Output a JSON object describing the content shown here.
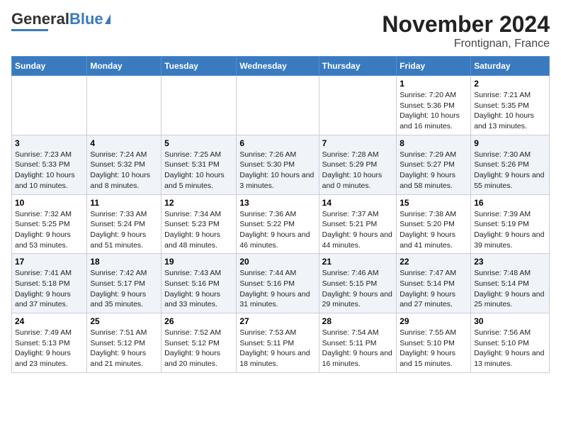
{
  "header": {
    "logo_general": "General",
    "logo_blue": "Blue",
    "title": "November 2024",
    "subtitle": "Frontignan, France"
  },
  "columns": [
    "Sunday",
    "Monday",
    "Tuesday",
    "Wednesday",
    "Thursday",
    "Friday",
    "Saturday"
  ],
  "weeks": [
    {
      "days": [
        {
          "num": "",
          "info": ""
        },
        {
          "num": "",
          "info": ""
        },
        {
          "num": "",
          "info": ""
        },
        {
          "num": "",
          "info": ""
        },
        {
          "num": "",
          "info": ""
        },
        {
          "num": "1",
          "info": "Sunrise: 7:20 AM\nSunset: 5:36 PM\nDaylight: 10 hours and 16 minutes."
        },
        {
          "num": "2",
          "info": "Sunrise: 7:21 AM\nSunset: 5:35 PM\nDaylight: 10 hours and 13 minutes."
        }
      ]
    },
    {
      "days": [
        {
          "num": "3",
          "info": "Sunrise: 7:23 AM\nSunset: 5:33 PM\nDaylight: 10 hours and 10 minutes."
        },
        {
          "num": "4",
          "info": "Sunrise: 7:24 AM\nSunset: 5:32 PM\nDaylight: 10 hours and 8 minutes."
        },
        {
          "num": "5",
          "info": "Sunrise: 7:25 AM\nSunset: 5:31 PM\nDaylight: 10 hours and 5 minutes."
        },
        {
          "num": "6",
          "info": "Sunrise: 7:26 AM\nSunset: 5:30 PM\nDaylight: 10 hours and 3 minutes."
        },
        {
          "num": "7",
          "info": "Sunrise: 7:28 AM\nSunset: 5:29 PM\nDaylight: 10 hours and 0 minutes."
        },
        {
          "num": "8",
          "info": "Sunrise: 7:29 AM\nSunset: 5:27 PM\nDaylight: 9 hours and 58 minutes."
        },
        {
          "num": "9",
          "info": "Sunrise: 7:30 AM\nSunset: 5:26 PM\nDaylight: 9 hours and 55 minutes."
        }
      ]
    },
    {
      "days": [
        {
          "num": "10",
          "info": "Sunrise: 7:32 AM\nSunset: 5:25 PM\nDaylight: 9 hours and 53 minutes."
        },
        {
          "num": "11",
          "info": "Sunrise: 7:33 AM\nSunset: 5:24 PM\nDaylight: 9 hours and 51 minutes."
        },
        {
          "num": "12",
          "info": "Sunrise: 7:34 AM\nSunset: 5:23 PM\nDaylight: 9 hours and 48 minutes."
        },
        {
          "num": "13",
          "info": "Sunrise: 7:36 AM\nSunset: 5:22 PM\nDaylight: 9 hours and 46 minutes."
        },
        {
          "num": "14",
          "info": "Sunrise: 7:37 AM\nSunset: 5:21 PM\nDaylight: 9 hours and 44 minutes."
        },
        {
          "num": "15",
          "info": "Sunrise: 7:38 AM\nSunset: 5:20 PM\nDaylight: 9 hours and 41 minutes."
        },
        {
          "num": "16",
          "info": "Sunrise: 7:39 AM\nSunset: 5:19 PM\nDaylight: 9 hours and 39 minutes."
        }
      ]
    },
    {
      "days": [
        {
          "num": "17",
          "info": "Sunrise: 7:41 AM\nSunset: 5:18 PM\nDaylight: 9 hours and 37 minutes."
        },
        {
          "num": "18",
          "info": "Sunrise: 7:42 AM\nSunset: 5:17 PM\nDaylight: 9 hours and 35 minutes."
        },
        {
          "num": "19",
          "info": "Sunrise: 7:43 AM\nSunset: 5:16 PM\nDaylight: 9 hours and 33 minutes."
        },
        {
          "num": "20",
          "info": "Sunrise: 7:44 AM\nSunset: 5:16 PM\nDaylight: 9 hours and 31 minutes."
        },
        {
          "num": "21",
          "info": "Sunrise: 7:46 AM\nSunset: 5:15 PM\nDaylight: 9 hours and 29 minutes."
        },
        {
          "num": "22",
          "info": "Sunrise: 7:47 AM\nSunset: 5:14 PM\nDaylight: 9 hours and 27 minutes."
        },
        {
          "num": "23",
          "info": "Sunrise: 7:48 AM\nSunset: 5:14 PM\nDaylight: 9 hours and 25 minutes."
        }
      ]
    },
    {
      "days": [
        {
          "num": "24",
          "info": "Sunrise: 7:49 AM\nSunset: 5:13 PM\nDaylight: 9 hours and 23 minutes."
        },
        {
          "num": "25",
          "info": "Sunrise: 7:51 AM\nSunset: 5:12 PM\nDaylight: 9 hours and 21 minutes."
        },
        {
          "num": "26",
          "info": "Sunrise: 7:52 AM\nSunset: 5:12 PM\nDaylight: 9 hours and 20 minutes."
        },
        {
          "num": "27",
          "info": "Sunrise: 7:53 AM\nSunset: 5:11 PM\nDaylight: 9 hours and 18 minutes."
        },
        {
          "num": "28",
          "info": "Sunrise: 7:54 AM\nSunset: 5:11 PM\nDaylight: 9 hours and 16 minutes."
        },
        {
          "num": "29",
          "info": "Sunrise: 7:55 AM\nSunset: 5:10 PM\nDaylight: 9 hours and 15 minutes."
        },
        {
          "num": "30",
          "info": "Sunrise: 7:56 AM\nSunset: 5:10 PM\nDaylight: 9 hours and 13 minutes."
        }
      ]
    }
  ]
}
